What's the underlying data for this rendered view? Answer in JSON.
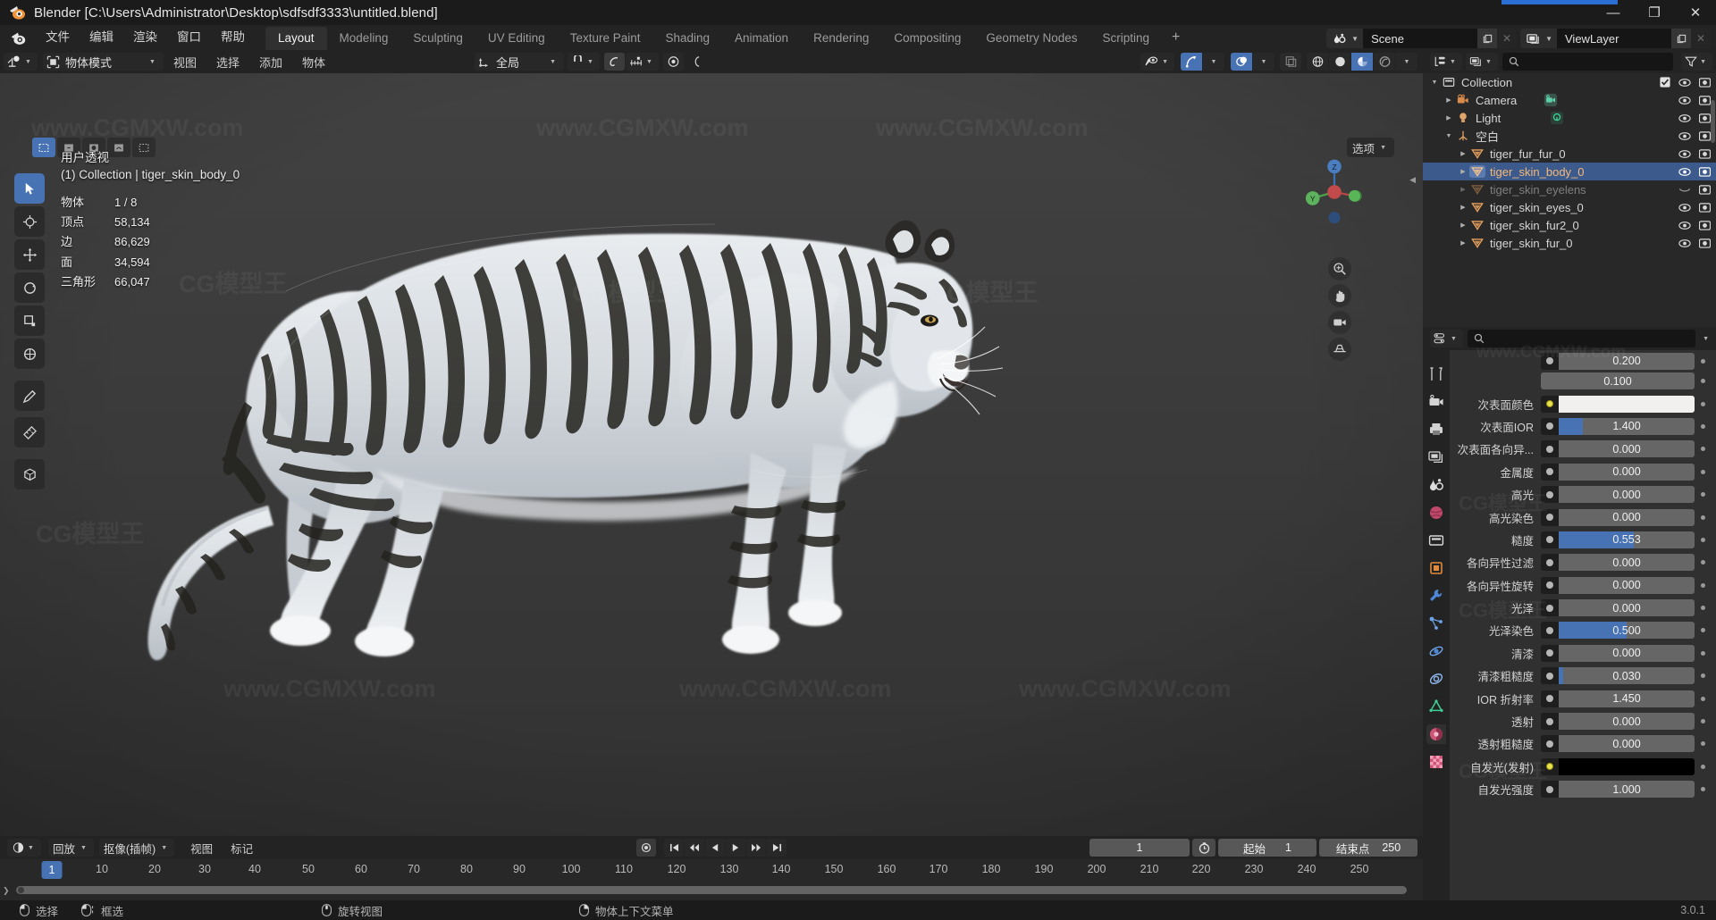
{
  "window": {
    "title": "Blender [C:\\Users\\Administrator\\Desktop\\sdfsdf3333\\untitled.blend]",
    "minimize": "—",
    "maximize": "❐",
    "close": "✕"
  },
  "topbar": {
    "menus": [
      "文件",
      "编辑",
      "渲染",
      "窗口",
      "帮助"
    ],
    "workspaces": [
      "Layout",
      "Modeling",
      "Sculpting",
      "UV Editing",
      "Texture Paint",
      "Shading",
      "Animation",
      "Rendering",
      "Compositing",
      "Geometry Nodes",
      "Scripting"
    ],
    "active_workspace": "Layout",
    "add_workspace": "+",
    "scene_name": "Scene",
    "viewlayer_name": "ViewLayer",
    "copy_icon": "copy-icon",
    "close_icon": "✕"
  },
  "viewport": {
    "mode": "物体模式",
    "menus": [
      "视图",
      "选择",
      "添加",
      "物体"
    ],
    "transform_orientation": "全局",
    "options_label": "选项",
    "info": {
      "perspective": "用户透视",
      "collection_line": "(1) Collection | tiger_skin_body_0"
    },
    "stats": [
      {
        "key": "物体",
        "value": "1 / 8"
      },
      {
        "key": "顶点",
        "value": "58,134"
      },
      {
        "key": "边",
        "value": "86,629"
      },
      {
        "key": "面",
        "value": "34,594"
      },
      {
        "key": "三角形",
        "value": "66,047"
      }
    ],
    "gizmo_axes": {
      "x": "X",
      "y": "Y",
      "z": "Z"
    }
  },
  "outliner": {
    "search_placeholder": "",
    "rows": [
      {
        "indent": 0,
        "tri": "▼",
        "icon": "collection-icon",
        "name": "Collection",
        "checkbox": true,
        "eye": true,
        "camera": true,
        "selected": false,
        "dim": false,
        "extra_icon": ""
      },
      {
        "indent": 1,
        "tri": "▶",
        "icon": "camera-icon",
        "name": "Camera",
        "checkbox": false,
        "eye": true,
        "camera": true,
        "selected": false,
        "dim": false,
        "extra_icon": "camera-data-icon"
      },
      {
        "indent": 1,
        "tri": "▶",
        "icon": "light-icon",
        "name": "Light",
        "checkbox": false,
        "eye": true,
        "camera": true,
        "selected": false,
        "dim": false,
        "extra_icon": "light-data-icon"
      },
      {
        "indent": 1,
        "tri": "▼",
        "icon": "empty-icon",
        "name": "空白",
        "checkbox": false,
        "eye": true,
        "camera": true,
        "selected": false,
        "dim": false,
        "extra_icon": ""
      },
      {
        "indent": 2,
        "tri": "▶",
        "icon": "mesh-icon",
        "name": "tiger_fur_fur_0",
        "checkbox": false,
        "eye": true,
        "camera": true,
        "selected": false,
        "dim": false,
        "extra_icon": ""
      },
      {
        "indent": 2,
        "tri": "▶",
        "icon": "mesh-icon",
        "name": "tiger_skin_body_0",
        "checkbox": false,
        "eye": true,
        "camera": true,
        "selected": true,
        "dim": false,
        "extra_icon": ""
      },
      {
        "indent": 2,
        "tri": "▶",
        "icon": "mesh-icon",
        "name": "tiger_skin_eyelens",
        "checkbox": false,
        "eye": false,
        "camera": true,
        "selected": false,
        "dim": true,
        "extra_icon": ""
      },
      {
        "indent": 2,
        "tri": "▶",
        "icon": "mesh-icon",
        "name": "tiger_skin_eyes_0",
        "checkbox": false,
        "eye": true,
        "camera": true,
        "selected": false,
        "dim": false,
        "extra_icon": ""
      },
      {
        "indent": 2,
        "tri": "▶",
        "icon": "mesh-icon",
        "name": "tiger_skin_fur2_0",
        "checkbox": false,
        "eye": true,
        "camera": true,
        "selected": false,
        "dim": false,
        "extra_icon": ""
      },
      {
        "indent": 2,
        "tri": "▶",
        "icon": "mesh-icon",
        "name": "tiger_skin_fur_0",
        "checkbox": false,
        "eye": true,
        "camera": true,
        "selected": false,
        "dim": false,
        "extra_icon": ""
      }
    ]
  },
  "properties": {
    "search_placeholder": "",
    "tabs": [
      "tool-icon",
      "render-icon",
      "output-icon",
      "viewlayer-icon",
      "scene-icon",
      "world-icon",
      "collection-icon",
      "object-icon",
      "modifier-icon",
      "particles-icon",
      "physics-icon",
      "constraint-icon",
      "data-icon",
      "material-icon",
      "texture-icon"
    ],
    "active_tab": "material-icon",
    "rows": [
      {
        "label": "",
        "value": "0.200",
        "type": "partial",
        "fill": 0,
        "socket": "gray"
      },
      {
        "label": "",
        "value": "0.100",
        "type": "slider",
        "fill": 0,
        "socket": "none"
      },
      {
        "label": "次表面颜色",
        "value": "",
        "type": "color-white",
        "fill": 0,
        "socket": "yellow"
      },
      {
        "label": "次表面IOR",
        "value": "1.400",
        "type": "slider",
        "fill": 0.18,
        "socket": "gray"
      },
      {
        "label": "次表面各向异...",
        "value": "0.000",
        "type": "slider",
        "fill": 0,
        "socket": "gray"
      },
      {
        "label": "金属度",
        "value": "0.000",
        "type": "slider",
        "fill": 0,
        "socket": "gray"
      },
      {
        "label": "高光",
        "value": "0.000",
        "type": "slider",
        "fill": 0,
        "socket": "gray"
      },
      {
        "label": "高光染色",
        "value": "0.000",
        "type": "slider",
        "fill": 0,
        "socket": "gray"
      },
      {
        "label": "糙度",
        "value": "0.553",
        "type": "slider",
        "fill": 0.553,
        "socket": "gray"
      },
      {
        "label": "各向异性过滤",
        "value": "0.000",
        "type": "slider",
        "fill": 0,
        "socket": "gray"
      },
      {
        "label": "各向异性旋转",
        "value": "0.000",
        "type": "slider",
        "fill": 0,
        "socket": "gray"
      },
      {
        "label": "光泽",
        "value": "0.000",
        "type": "slider",
        "fill": 0,
        "socket": "gray"
      },
      {
        "label": "光泽染色",
        "value": "0.500",
        "type": "slider",
        "fill": 0.5,
        "socket": "gray"
      },
      {
        "label": "清漆",
        "value": "0.000",
        "type": "slider",
        "fill": 0,
        "socket": "gray"
      },
      {
        "label": "清漆粗糙度",
        "value": "0.030",
        "type": "slider",
        "fill": 0.03,
        "socket": "gray"
      },
      {
        "label": "IOR 折射率",
        "value": "1.450",
        "type": "slider",
        "fill": 0,
        "socket": "gray"
      },
      {
        "label": "透射",
        "value": "0.000",
        "type": "slider",
        "fill": 0,
        "socket": "gray"
      },
      {
        "label": "透射粗糙度",
        "value": "0.000",
        "type": "slider",
        "fill": 0,
        "socket": "gray"
      },
      {
        "label": "自发光(发射)",
        "value": "",
        "type": "color-black",
        "fill": 0,
        "socket": "yellow"
      },
      {
        "label": "自发光强度",
        "value": "1.000",
        "type": "slider",
        "fill": 0,
        "socket": "gray"
      }
    ]
  },
  "timeline": {
    "editor_icon": "clock-icon",
    "playback_label": "回放",
    "keying_label": "抠像(插帧)",
    "menus": [
      "视图",
      "标记"
    ],
    "transport": [
      "⏮",
      "⏪",
      "◀",
      "▶",
      "⏩",
      "⏭"
    ],
    "record_icon": "record-icon",
    "current_frame": "1",
    "start_label": "起始",
    "start_value": "1",
    "end_label": "结束点",
    "end_value": "250",
    "ticks": [
      1,
      10,
      20,
      30,
      40,
      50,
      60,
      70,
      80,
      90,
      100,
      110,
      120,
      130,
      140,
      150,
      160,
      170,
      180,
      190,
      200,
      210,
      220,
      230,
      240,
      250
    ],
    "playhead_frame": "1"
  },
  "statusbar": {
    "items": [
      {
        "icon": "mouse-left-icon",
        "label": "选择"
      },
      {
        "icon": "mouse-left-drag-icon",
        "label": "框选"
      },
      {
        "icon": "mouse-middle-icon",
        "label": "旋转视图"
      },
      {
        "icon": "mouse-right-icon",
        "label": "物体上下文菜单"
      }
    ],
    "version": "3.0.1"
  },
  "colors": {
    "accent_blue": "#4772b3",
    "select_orange": "#ed9e5c",
    "viewport_bg": "#3b3b3b",
    "panel_bg": "#303030",
    "header_bg": "#232323"
  },
  "watermarks": [
    "www.CGMXW.com",
    "CG模型王"
  ]
}
